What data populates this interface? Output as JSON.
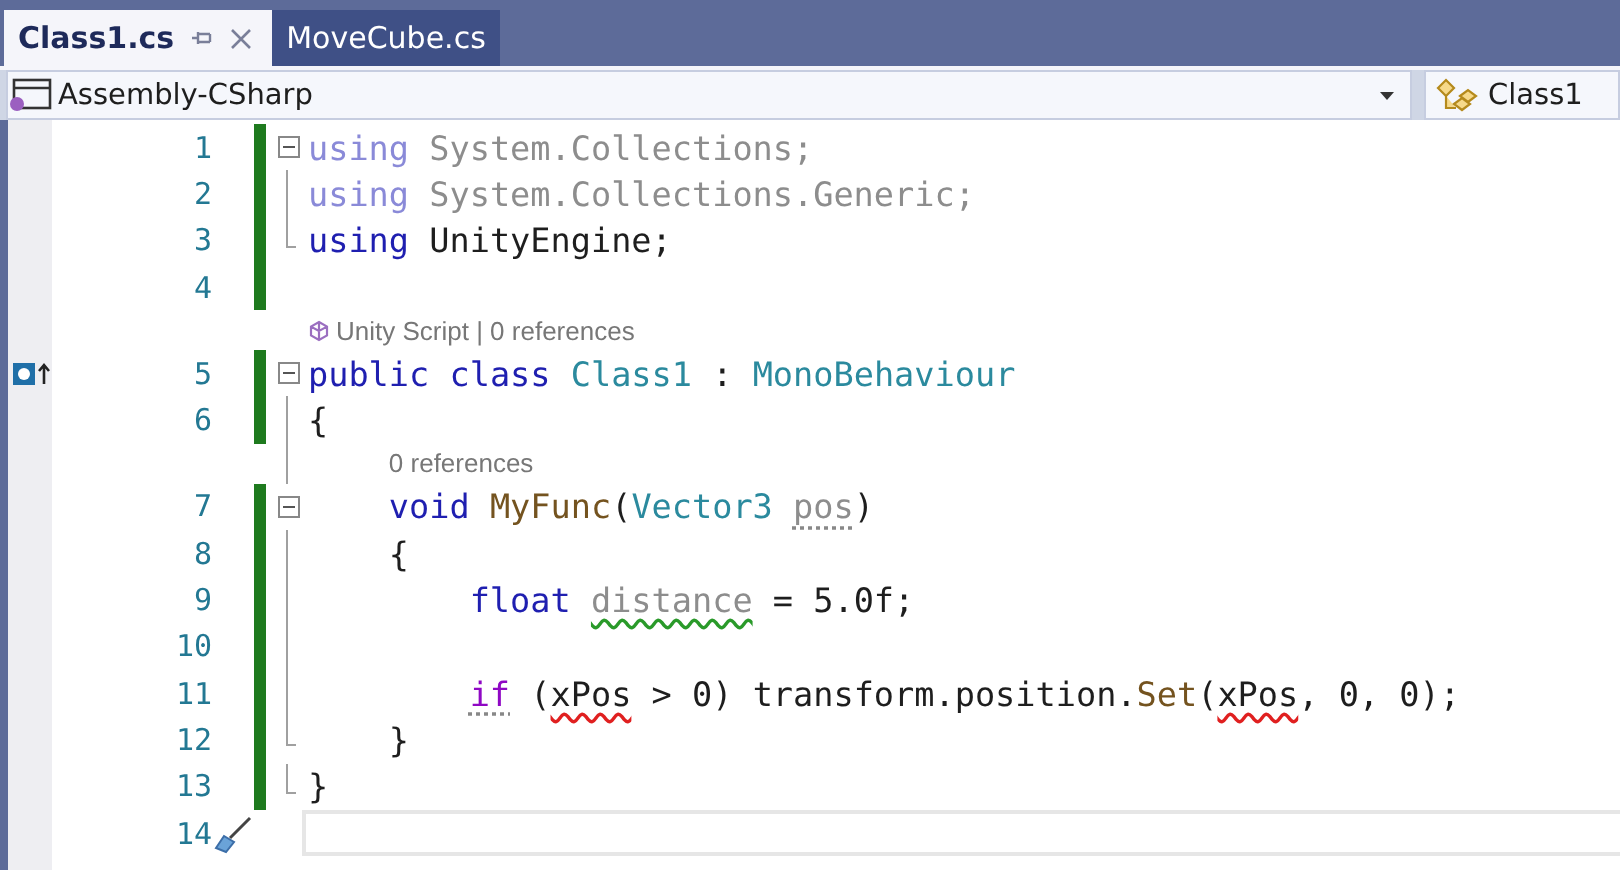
{
  "tabs": [
    {
      "label": "Class1.cs",
      "selected": true,
      "pinned": false
    },
    {
      "label": "MoveCube.cs",
      "selected": false
    }
  ],
  "navigation": {
    "project": "Assembly-CSharp",
    "member": "Class1"
  },
  "lines": [
    {
      "number": "1",
      "changed": true,
      "collapsible": true,
      "fold_end": false,
      "implementation": false,
      "quick_action": false,
      "tokens": [
        {
          "text": "using",
          "kind": "keyword_faded"
        },
        {
          "text": " System.Collections;",
          "kind": "faded"
        }
      ]
    },
    {
      "number": "2",
      "changed": true,
      "collapsible": false,
      "fold_end": false,
      "implementation": false,
      "quick_action": false,
      "tokens": [
        {
          "text": "using",
          "kind": "keyword_faded"
        },
        {
          "text": " System.Collections.Generic;",
          "kind": "faded"
        }
      ]
    },
    {
      "number": "3",
      "changed": true,
      "collapsible": false,
      "fold_end": true,
      "implementation": false,
      "quick_action": false,
      "tokens": [
        {
          "text": "using",
          "kind": "keyword"
        },
        {
          "text": " UnityEngine;",
          "kind": "plain"
        }
      ]
    },
    {
      "number": "4",
      "changed": true,
      "collapsible": false,
      "fold_end": false,
      "implementation": false,
      "quick_action": false
    },
    {
      "number": "5",
      "changed": true,
      "collapsible": true,
      "fold_end": false,
      "implementation": true,
      "quick_action": false,
      "codelens": {
        "icon": true,
        "text": "Unity Script | 0 references"
      },
      "tokens": [
        {
          "text": "public",
          "kind": "keyword"
        },
        {
          "text": " class",
          "kind": "keyword"
        },
        {
          "text": " Class1",
          "kind": "type"
        },
        {
          "text": " : ",
          "kind": "plain"
        },
        {
          "text": "MonoBehaviour",
          "kind": "type"
        }
      ]
    },
    {
      "number": "6",
      "changed": true,
      "collapsible": false,
      "fold_end": false,
      "implementation": false,
      "quick_action": false,
      "tokens": [
        {
          "text": "{",
          "kind": "plain"
        }
      ]
    },
    {
      "number": "7",
      "changed": true,
      "collapsible": true,
      "fold_end": false,
      "implementation": false,
      "quick_action": false,
      "codelens": {
        "icon": false,
        "text": "0 references"
      },
      "tokens": [
        {
          "text": "    void",
          "kind": "keyword"
        },
        {
          "text": " MyFunc",
          "kind": "method"
        },
        {
          "text": "(",
          "kind": "plain"
        },
        {
          "text": "Vector3 ",
          "kind": "type"
        },
        {
          "text": "pos",
          "kind": "faded",
          "suggestion_dots": true
        },
        {
          "text": ")",
          "kind": "plain"
        }
      ]
    },
    {
      "number": "8",
      "changed": true,
      "collapsible": false,
      "fold_end": false,
      "implementation": false,
      "quick_action": false,
      "tokens": [
        {
          "text": "    {",
          "kind": "plain"
        }
      ]
    },
    {
      "number": "9",
      "changed": true,
      "collapsible": false,
      "fold_end": false,
      "implementation": false,
      "quick_action": false,
      "tokens": [
        {
          "text": "        float ",
          "kind": "keyword"
        },
        {
          "text": "distance",
          "kind": "faded",
          "warning_squiggle": true
        },
        {
          "text": " = 5.0f;",
          "kind": "plain"
        }
      ]
    },
    {
      "number": "10",
      "changed": true,
      "collapsible": false,
      "fold_end": false,
      "implementation": false,
      "quick_action": false
    },
    {
      "number": "11",
      "changed": true,
      "collapsible": false,
      "fold_end": false,
      "implementation": false,
      "quick_action": false,
      "tokens": [
        {
          "text": "        if",
          "kind": "control",
          "suggestion_dots": true
        },
        {
          "text": " (",
          "kind": "plain"
        },
        {
          "text": "xPos",
          "kind": "plain",
          "error_squiggle": true
        },
        {
          "text": " > 0) transform.position.",
          "kind": "plain"
        },
        {
          "text": "Set",
          "kind": "method"
        },
        {
          "text": "(",
          "kind": "plain"
        },
        {
          "text": "xPos",
          "kind": "plain",
          "error_squiggle": true
        },
        {
          "text": ", 0, 0);",
          "kind": "plain"
        }
      ]
    },
    {
      "number": "12",
      "changed": true,
      "collapsible": false,
      "fold_end": true,
      "implementation": false,
      "quick_action": false,
      "tokens": [
        {
          "text": "    }",
          "kind": "plain"
        }
      ]
    },
    {
      "number": "13",
      "changed": true,
      "collapsible": false,
      "fold_end": true,
      "implementation": false,
      "quick_action": false,
      "tokens": [
        {
          "text": "}",
          "kind": "plain"
        }
      ]
    },
    {
      "number": "14",
      "changed": false,
      "collapsible": false,
      "fold_end": false,
      "implementation": false,
      "quick_action": true,
      "current": true
    }
  ]
}
